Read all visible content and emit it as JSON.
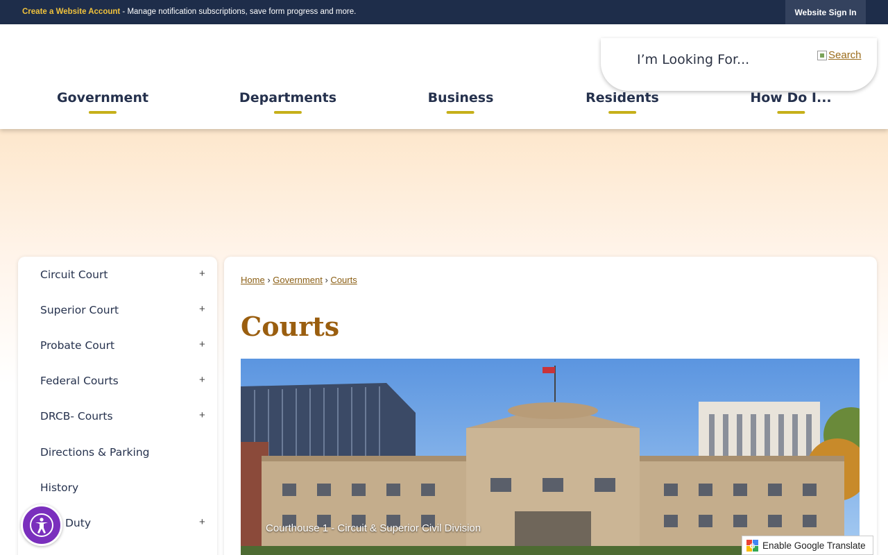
{
  "topbar": {
    "account_link": "Create a Website Account",
    "account_text": " - Manage notification subscriptions, save form progress and more.",
    "signin": "Website Sign In"
  },
  "search": {
    "placeholder": "I’m Looking For...",
    "button_alt": "Search"
  },
  "nav": {
    "items": [
      "Government",
      "Departments",
      "Business",
      "Residents",
      "How Do I..."
    ]
  },
  "sidebar": {
    "items": [
      {
        "label": "Circuit Court",
        "expandable": "+"
      },
      {
        "label": "Superior Court",
        "expandable": "+"
      },
      {
        "label": "Probate Court",
        "expandable": "+"
      },
      {
        "label": "Federal Courts",
        "expandable": "+"
      },
      {
        "label": "DRCB- Courts",
        "expandable": "+"
      },
      {
        "label": "Directions & Parking",
        "expandable": ""
      },
      {
        "label": "History",
        "expandable": ""
      },
      {
        "label": "Duty",
        "expandable": "+"
      }
    ]
  },
  "breadcrumb": {
    "home": "Home",
    "sep": "›",
    "government": "Government",
    "courts": "Courts"
  },
  "page": {
    "title": "Courts",
    "photo_caption": "Courthouse 1 - Circuit & Superior Civil Division"
  },
  "translate": {
    "label": "Enable Google Translate"
  },
  "colors": {
    "topbar": "#1e2d4a",
    "accent_underline": "#c6b01a",
    "title": "#9a5e0f",
    "a11y": "#7a2fbd"
  }
}
